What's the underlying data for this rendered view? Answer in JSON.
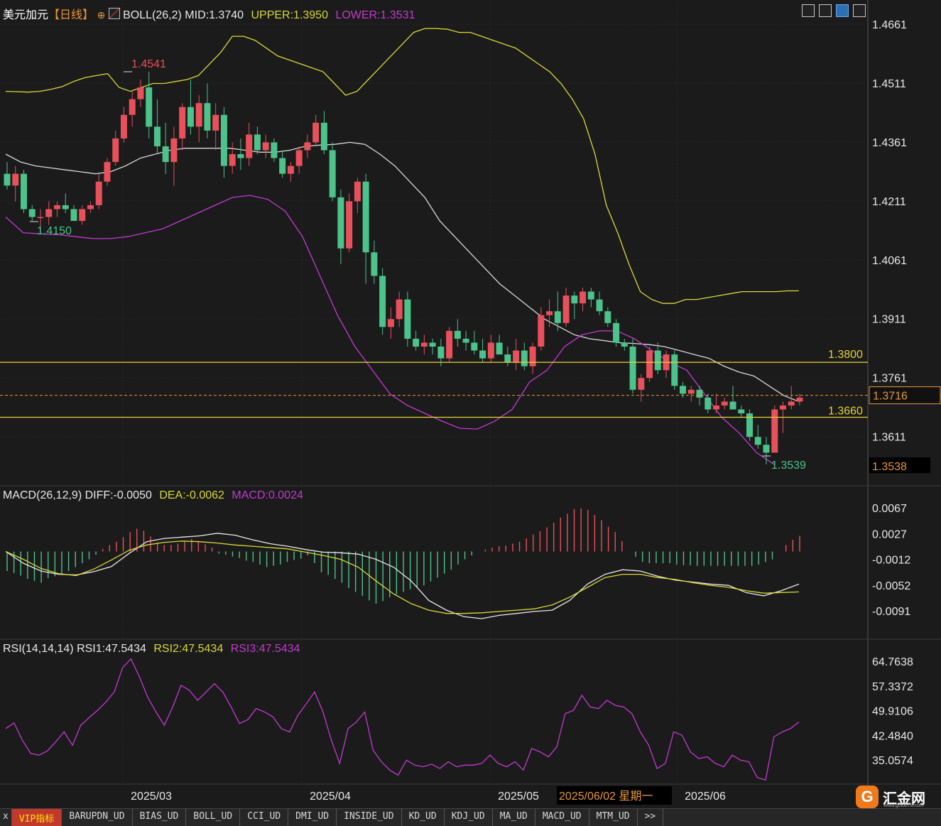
{
  "header": {
    "symbol": "美元加元",
    "period": "【日线】",
    "add_icon": "plus-circle-icon",
    "indicator_icon": "chart-indicator-icon",
    "boll": "BOLL(26,2)",
    "mid": "MID:1.3740",
    "upper": "UPPER:1.3950",
    "lower": "LOWER:1.3531"
  },
  "toolbar": {
    "icons": [
      "crosshair-icon",
      "chart-type-icon",
      "draw-tool-icon",
      "layout-icon"
    ]
  },
  "price_labels": {
    "high": "1.4541",
    "low_left": "1.4150",
    "low_right": "1.3539",
    "line_upper": "1.3800",
    "line_lower": "1.3660",
    "current": "1.3716",
    "cursor": "1.3538"
  },
  "macd_header": {
    "label": "MACD(26,12,9)",
    "diff": "DIFF:-0.0050",
    "dea": "DEA:-0.0062",
    "macd": "MACD:0.0024"
  },
  "rsi_header": {
    "label": "RSI(14,14,14)",
    "rsi1": "RSI1:47.5434",
    "rsi2": "RSI2:47.5434",
    "rsi3": "RSI3:47.5434"
  },
  "date_cursor": "2025/06/02 星期一",
  "tabs": [
    "VIP指标",
    "BARUPDN_UD",
    "BIAS_UD",
    "BOLL_UD",
    "CCI_UD",
    "DMI_UD",
    "INSIDE_UD",
    "KD_UD",
    "KDJ_UD",
    "MA_UD",
    "MACD_UD",
    "MTM_UD",
    ">>"
  ],
  "active_tab": 0,
  "tab_prefix": "x",
  "logo": {
    "mark": "G",
    "text": "汇金网",
    "url": "www.gold678.com"
  },
  "colors": {
    "background": "#1b1b1b",
    "up": "#e8505b",
    "down": "#4cc38a",
    "boll_upper": "#d8d83a",
    "boll_mid": "#d8d8d8",
    "boll_lower": "#c23ad0",
    "level_line": "#e6d23a",
    "current_line": "#e8963a",
    "macd_diff": "#e8e8e8",
    "macd_dea": "#d8d83a",
    "rsi": "#c23ad0"
  },
  "chart_data": [
    {
      "type": "candlestick",
      "title": "美元加元【日线】",
      "y_ticks": [
        "1.4661",
        "1.4511",
        "1.4361",
        "1.4211",
        "1.4061",
        "1.3911",
        "1.3761",
        "1.3611"
      ],
      "ylim": [
        1.353,
        1.4665
      ],
      "x_ticks": [
        "2025/03",
        "2025/04",
        "2025/05",
        "2025/06"
      ],
      "horizontal_lines": [
        1.38,
        1.366,
        1.3716
      ],
      "ohlc": [
        [
          1.428,
          1.431,
          1.424,
          1.425
        ],
        [
          1.425,
          1.43,
          1.421,
          1.428
        ],
        [
          1.428,
          1.429,
          1.418,
          1.419
        ],
        [
          1.419,
          1.42,
          1.416,
          1.417
        ],
        [
          1.417,
          1.419,
          1.413,
          1.417
        ],
        [
          1.417,
          1.421,
          1.415,
          1.419
        ],
        [
          1.419,
          1.421,
          1.417,
          1.42
        ],
        [
          1.42,
          1.423,
          1.418,
          1.419
        ],
        [
          1.419,
          1.42,
          1.416,
          1.416
        ],
        [
          1.416,
          1.42,
          1.415,
          1.419
        ],
        [
          1.419,
          1.421,
          1.418,
          1.42
        ],
        [
          1.42,
          1.428,
          1.419,
          1.426
        ],
        [
          1.426,
          1.432,
          1.425,
          1.431
        ],
        [
          1.431,
          1.439,
          1.43,
          1.437
        ],
        [
          1.437,
          1.445,
          1.436,
          1.443
        ],
        [
          1.443,
          1.449,
          1.44,
          1.447
        ],
        [
          1.447,
          1.452,
          1.445,
          1.45
        ],
        [
          1.45,
          1.454,
          1.437,
          1.44
        ],
        [
          1.44,
          1.447,
          1.433,
          1.435
        ],
        [
          1.435,
          1.441,
          1.428,
          1.431
        ],
        [
          1.431,
          1.44,
          1.425,
          1.437
        ],
        [
          1.437,
          1.446,
          1.434,
          1.445
        ],
        [
          1.445,
          1.452,
          1.438,
          1.44
        ],
        [
          1.44,
          1.448,
          1.436,
          1.446
        ],
        [
          1.446,
          1.451,
          1.437,
          1.439
        ],
        [
          1.439,
          1.446,
          1.434,
          1.443
        ],
        [
          1.443,
          1.445,
          1.427,
          1.43
        ],
        [
          1.43,
          1.436,
          1.428,
          1.433
        ],
        [
          1.433,
          1.437,
          1.429,
          1.432
        ],
        [
          1.432,
          1.441,
          1.43,
          1.438
        ],
        [
          1.438,
          1.44,
          1.433,
          1.434
        ],
        [
          1.434,
          1.438,
          1.432,
          1.436
        ],
        [
          1.436,
          1.437,
          1.431,
          1.432
        ],
        [
          1.432,
          1.434,
          1.427,
          1.428
        ],
        [
          1.428,
          1.431,
          1.426,
          1.43
        ],
        [
          1.43,
          1.435,
          1.428,
          1.434
        ],
        [
          1.434,
          1.438,
          1.432,
          1.436
        ],
        [
          1.436,
          1.443,
          1.435,
          1.441
        ],
        [
          1.441,
          1.444,
          1.433,
          1.434
        ],
        [
          1.434,
          1.436,
          1.421,
          1.422
        ],
        [
          1.422,
          1.424,
          1.405,
          1.409
        ],
        [
          1.409,
          1.423,
          1.408,
          1.421
        ],
        [
          1.421,
          1.427,
          1.418,
          1.426
        ],
        [
          1.426,
          1.428,
          1.4,
          1.408
        ],
        [
          1.408,
          1.411,
          1.4,
          1.402
        ],
        [
          1.402,
          1.404,
          1.387,
          1.389
        ],
        [
          1.389,
          1.394,
          1.386,
          1.391
        ],
        [
          1.391,
          1.398,
          1.389,
          1.396
        ],
        [
          1.396,
          1.398,
          1.384,
          1.386
        ],
        [
          1.386,
          1.388,
          1.383,
          1.384
        ],
        [
          1.384,
          1.387,
          1.382,
          1.385
        ],
        [
          1.385,
          1.386,
          1.382,
          1.384
        ],
        [
          1.384,
          1.386,
          1.379,
          1.381
        ],
        [
          1.381,
          1.389,
          1.38,
          1.388
        ],
        [
          1.388,
          1.391,
          1.384,
          1.386
        ],
        [
          1.386,
          1.388,
          1.383,
          1.385
        ],
        [
          1.385,
          1.388,
          1.382,
          1.383
        ],
        [
          1.383,
          1.386,
          1.38,
          1.381
        ],
        [
          1.381,
          1.387,
          1.38,
          1.385
        ],
        [
          1.385,
          1.387,
          1.382,
          1.382
        ],
        [
          1.382,
          1.384,
          1.379,
          1.38
        ],
        [
          1.38,
          1.386,
          1.378,
          1.383
        ],
        [
          1.383,
          1.385,
          1.378,
          1.379
        ],
        [
          1.379,
          1.385,
          1.377,
          1.384
        ],
        [
          1.384,
          1.394,
          1.383,
          1.392
        ],
        [
          1.392,
          1.396,
          1.389,
          1.393
        ],
        [
          1.393,
          1.398,
          1.388,
          1.39
        ],
        [
          1.39,
          1.399,
          1.389,
          1.397
        ],
        [
          1.397,
          1.398,
          1.391,
          1.395
        ],
        [
          1.395,
          1.399,
          1.393,
          1.398
        ],
        [
          1.398,
          1.399,
          1.394,
          1.396
        ],
        [
          1.396,
          1.398,
          1.392,
          1.393
        ],
        [
          1.393,
          1.394,
          1.389,
          1.39
        ],
        [
          1.39,
          1.391,
          1.384,
          1.385
        ],
        [
          1.385,
          1.386,
          1.383,
          1.384
        ],
        [
          1.384,
          1.386,
          1.372,
          1.373
        ],
        [
          1.373,
          1.377,
          1.37,
          1.376
        ],
        [
          1.376,
          1.384,
          1.375,
          1.383
        ],
        [
          1.383,
          1.385,
          1.377,
          1.378
        ],
        [
          1.378,
          1.383,
          1.376,
          1.382
        ],
        [
          1.382,
          1.383,
          1.373,
          1.374
        ],
        [
          1.374,
          1.375,
          1.371,
          1.372
        ],
        [
          1.372,
          1.374,
          1.37,
          1.373
        ],
        [
          1.373,
          1.374,
          1.369,
          1.371
        ],
        [
          1.371,
          1.372,
          1.367,
          1.368
        ],
        [
          1.368,
          1.372,
          1.367,
          1.369
        ],
        [
          1.369,
          1.371,
          1.368,
          1.37
        ],
        [
          1.37,
          1.374,
          1.368,
          1.368
        ],
        [
          1.368,
          1.369,
          1.366,
          1.367
        ],
        [
          1.367,
          1.368,
          1.36,
          1.361
        ],
        [
          1.361,
          1.364,
          1.358,
          1.359
        ],
        [
          1.359,
          1.361,
          1.354,
          1.357
        ],
        [
          1.357,
          1.369,
          1.357,
          1.368
        ],
        [
          1.368,
          1.37,
          1.362,
          1.369
        ],
        [
          1.369,
          1.374,
          1.368,
          1.37
        ],
        [
          1.37,
          1.372,
          1.369,
          1.371
        ]
      ],
      "boll_upper": [
        1.449,
        1.4489,
        1.4488,
        1.449,
        1.4495,
        1.4502,
        1.4515,
        1.4525,
        1.453,
        1.4535,
        1.45,
        1.449,
        1.45,
        1.451,
        1.451,
        1.4515,
        1.452,
        1.453,
        1.456,
        1.459,
        1.463,
        1.463,
        1.462,
        1.46,
        1.458,
        1.457,
        1.456,
        1.455,
        1.454,
        1.451,
        1.448,
        1.449,
        1.452,
        1.455,
        1.458,
        1.461,
        1.464,
        1.465,
        1.465,
        1.4648,
        1.464,
        1.464,
        1.463,
        1.462,
        1.461,
        1.46,
        1.458,
        1.456,
        1.454,
        1.451,
        1.447,
        1.442,
        1.433,
        1.42,
        1.413,
        1.405,
        1.398,
        1.396,
        1.395,
        1.395,
        1.396,
        1.396,
        1.3965,
        1.397,
        1.3975,
        1.398,
        1.398,
        1.398,
        1.398,
        1.3982,
        1.3982
      ],
      "boll_mid": [
        1.433,
        1.431,
        1.43,
        1.4295,
        1.429,
        1.4285,
        1.428,
        1.4285,
        1.43,
        1.432,
        1.433,
        1.434,
        1.4345,
        1.4345,
        1.4345,
        1.4345,
        1.434,
        1.4335,
        1.4335,
        1.434,
        1.435,
        1.4353,
        1.4355,
        1.436,
        1.4355,
        1.433,
        1.43,
        1.426,
        1.422,
        1.416,
        1.412,
        1.408,
        1.404,
        1.4,
        1.397,
        1.394,
        1.391,
        1.389,
        1.387,
        1.386,
        1.3855,
        1.385,
        1.3848,
        1.3845,
        1.384,
        1.383,
        1.382,
        1.381,
        1.379,
        1.3775,
        1.3765,
        1.374,
        1.3715,
        1.37
      ],
      "boll_lower": [
        1.417,
        1.413,
        1.4127,
        1.4125,
        1.412,
        1.4115,
        1.4115,
        1.412,
        1.413,
        1.414,
        1.416,
        1.418,
        1.42,
        1.422,
        1.4225,
        1.4215,
        1.4185,
        1.412,
        1.402,
        1.392,
        1.384,
        1.378,
        1.372,
        1.369,
        1.367,
        1.365,
        1.3632,
        1.363,
        1.365,
        1.368,
        1.375,
        1.378,
        1.384,
        1.387,
        1.388,
        1.388,
        1.386,
        1.383,
        1.38,
        1.378,
        1.372,
        1.366,
        1.362,
        1.357,
        1.354
      ]
    },
    {
      "type": "bar+line",
      "title": "MACD(26,12,9)",
      "y_ticks": [
        "0.0067",
        "0.0027",
        "-0.0012",
        "-0.0052",
        "-0.0091"
      ],
      "ylim": [
        -0.0102,
        0.0071
      ],
      "macd": [
        -0.003,
        -0.0033,
        -0.0037,
        -0.0042,
        -0.0045,
        -0.0048,
        -0.0041,
        -0.0038,
        -0.0036,
        -0.003,
        -0.0024,
        -0.0018,
        -0.0012,
        -0.0005,
        0.0004,
        0.001,
        0.0015,
        0.0022,
        0.003,
        0.0035,
        0.0032,
        0.0023,
        0.0014,
        0.001,
        0.001,
        0.0012,
        0.0016,
        0.0019,
        0.0016,
        0.0011,
        0.0006,
        -0.0003,
        -0.0005,
        -0.0008,
        -0.001,
        -0.0014,
        -0.0016,
        -0.002,
        -0.0024,
        -0.0022,
        -0.002,
        -0.0016,
        -0.0013,
        -0.0011,
        -0.0006,
        -0.0018,
        -0.0032,
        -0.0036,
        -0.0042,
        -0.0048,
        -0.0056,
        -0.0062,
        -0.0068,
        -0.0075,
        -0.008,
        -0.0076,
        -0.007,
        -0.0066,
        -0.0062,
        -0.0058,
        -0.0055,
        -0.0052,
        -0.0046,
        -0.004,
        -0.0034,
        -0.0028,
        -0.002,
        -0.0012,
        -0.0006,
        0.0,
        0.0003,
        0.0006,
        0.0008,
        0.0009,
        0.0012,
        0.0015,
        0.002,
        0.0026,
        0.0031,
        0.0037,
        0.0044,
        0.0052,
        0.0058,
        0.0065,
        0.0066,
        0.0064,
        0.0056,
        0.0048,
        0.0038,
        0.003,
        0.0016,
        0.0,
        -0.0008,
        -0.0016,
        -0.0018,
        -0.0018,
        -0.0018,
        -0.0018,
        -0.002,
        -0.0021,
        -0.0021,
        -0.0022,
        -0.0022,
        -0.0022,
        -0.0022,
        -0.0022,
        -0.0022,
        -0.0022,
        -0.0022,
        -0.0022,
        -0.002,
        -0.0016,
        -0.0012,
        0.0,
        0.001,
        0.0018,
        0.0024
      ],
      "diff": [
        0.0,
        -0.0018,
        -0.003,
        -0.0035,
        -0.0036,
        -0.0031,
        -0.0023,
        -0.0003,
        0.0015,
        0.002,
        0.0022,
        0.0024,
        0.0028,
        0.0025,
        0.0018,
        0.0012,
        0.0008,
        0.0003,
        -0.0001,
        -0.0002,
        -0.0004,
        -0.0012,
        -0.0024,
        -0.0045,
        -0.0075,
        -0.009,
        -0.01,
        -0.0103,
        -0.0098,
        -0.0095,
        -0.0092,
        -0.009,
        -0.0075,
        -0.005,
        -0.0035,
        -0.0028,
        -0.003,
        -0.0038,
        -0.0044,
        -0.0047,
        -0.005,
        -0.0052,
        -0.0063,
        -0.0068,
        -0.006,
        -0.005
      ],
      "dea": [
        0.0,
        -0.0012,
        -0.0026,
        -0.0034,
        -0.0037,
        -0.0027,
        -0.0013,
        0.0002,
        0.001,
        0.0014,
        0.0016,
        0.0015,
        0.0013,
        0.001,
        0.0008,
        0.0006,
        0.0004,
        -0.0001,
        -0.0006,
        -0.0012,
        -0.0024,
        -0.0045,
        -0.0065,
        -0.008,
        -0.009,
        -0.0095,
        -0.0095,
        -0.0094,
        -0.0092,
        -0.009,
        -0.0088,
        -0.0082,
        -0.007,
        -0.0055,
        -0.004,
        -0.0035,
        -0.0035,
        -0.004,
        -0.0043,
        -0.0048,
        -0.0052,
        -0.0055,
        -0.006,
        -0.0064,
        -0.0063,
        -0.0062
      ]
    },
    {
      "type": "line",
      "title": "RSI(14,14,14)",
      "y_ticks": [
        "64.7638",
        "57.3372",
        "49.9106",
        "42.4840",
        "35.0574"
      ],
      "ylim": [
        29.5,
        66.5
      ],
      "rsi": [
        44.5,
        46.2,
        41.0,
        37.0,
        36.5,
        37.8,
        40.5,
        43.5,
        39.5,
        45.5,
        47.8,
        50.0,
        52.5,
        55.5,
        62.8,
        65.5,
        60.2,
        54.0,
        49.5,
        45.5,
        51.0,
        57.5,
        56.0,
        53.0,
        55.5,
        58.0,
        55.5,
        51.0,
        46.0,
        47.2,
        50.5,
        49.5,
        48.0,
        44.5,
        43.5,
        48.5,
        52.0,
        55.5,
        49.5,
        41.0,
        34.0,
        44.5,
        46.5,
        49.5,
        38.0,
        34.5,
        32.0,
        30.5,
        35.0,
        33.5,
        33.0,
        33.8,
        32.5,
        34.5,
        33.0,
        33.5,
        33.5,
        34.0,
        36.5,
        34.0,
        33.0,
        34.5,
        32.0,
        38.5,
        37.5,
        36.0,
        39.0,
        49.0,
        50.0,
        54.5,
        51.0,
        50.5,
        53.0,
        51.5,
        51.0,
        49.0,
        43.5,
        39.5,
        32.5,
        34.0,
        43.5,
        42.5,
        37.5,
        35.5,
        36.0,
        34.0,
        33.0,
        36.5,
        35.0,
        34.5,
        29.8,
        29.0,
        42.0,
        43.5,
        44.5,
        46.5
      ],
      "rsi_x_scale": 12.0
    }
  ]
}
